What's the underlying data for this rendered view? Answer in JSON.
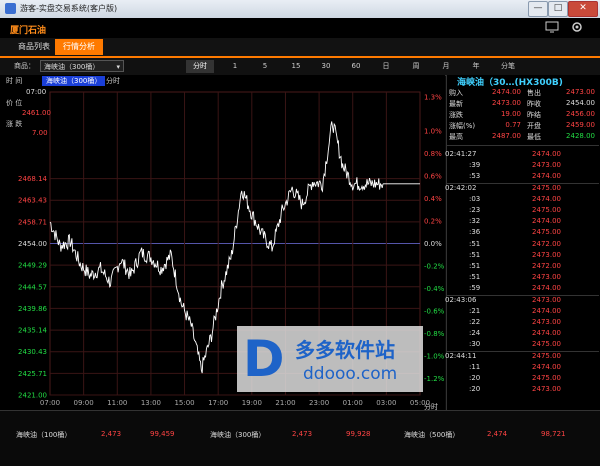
{
  "window": {
    "title": "游客-实盘交易系统(客户版)",
    "min": "—",
    "max": "□",
    "close": "✕"
  },
  "header": {
    "logo": "厦门石油"
  },
  "tabs": [
    {
      "label": "商品列表"
    },
    {
      "label": "行情分析"
    }
  ],
  "toolbar": {
    "goods_label": "商品：",
    "selected": "海峡油（300桶）",
    "periods": [
      "分时",
      "1",
      "5",
      "15",
      "30",
      "60",
      "日",
      "周",
      "月",
      "年",
      "分笔"
    ]
  },
  "chart": {
    "left_labels": {
      "time": "时 间",
      "time_val": "07:00",
      "price": "价 位",
      "price_val": "2461.00",
      "change": "涨 跌",
      "change_val": "7.00"
    },
    "legend": "海峡油（300桶）",
    "legend_suffix": "分时",
    "x_unit": "分时",
    "colors": {
      "up": "#ff4444",
      "down": "#22dd44",
      "line": "#ffffff",
      "grid": "#3a1515",
      "accent": "#ff7a00"
    }
  },
  "chart_data": {
    "type": "line",
    "title": "海峡油（300桶）",
    "xlabel": "分时",
    "ylabel": "",
    "x_ticks": [
      "07:00",
      "09:00",
      "11:00",
      "13:00",
      "15:00",
      "17:00",
      "19:00",
      "21:00",
      "23:00",
      "01:00",
      "03:00",
      "05:00"
    ],
    "y_ticks": [
      "2468.14",
      "2463.43",
      "2458.71",
      "2454.00",
      "2449.29",
      "2444.57",
      "2439.86",
      "2435.14",
      "2430.43",
      "2425.71",
      "2421.00"
    ],
    "pct_ticks": [
      "1.3%",
      "1.0%",
      "0.8%",
      "0.6%",
      "0.4%",
      "0.2%",
      "0.0%",
      "-0.2%",
      "-0.4%",
      "-0.6%",
      "-0.8%",
      "-1.0%",
      "-1.2%"
    ],
    "ylim": [
      2421.0,
      2487.0
    ],
    "base": 2454.0,
    "series": [
      {
        "x": [
          "07:00",
          "08:00",
          "09:00",
          "10:00",
          "11:00",
          "12:00",
          "13:00",
          "14:00",
          "15:00",
          "16:00",
          "17:00",
          "17:30",
          "18:00",
          "18:30",
          "19:00",
          "19:30",
          "20:00",
          "20:30",
          "21:00",
          "21:30",
          "22:00",
          "22:30",
          "23:00",
          "23:30",
          "00:00",
          "00:30",
          "01:00",
          "01:30",
          "02:00",
          "02:30",
          "03:00",
          "03:30",
          "04:00",
          "04:30"
        ],
        "values": [
          2458.7,
          2453.5,
          2454.5,
          2449.5,
          2447.0,
          2448.5,
          2445.5,
          2450.5,
          2447.0,
          2452.0,
          2451.0,
          2448.5,
          2451.5,
          2441.0,
          2436.0,
          2426.5,
          2434.0,
          2444.5,
          2451.5,
          2466.0,
          2460.5,
          2456.0,
          2453.0,
          2461.0,
          2466.0,
          2462.5,
          2467.5,
          2467.0,
          2480.5,
          2471.0,
          2467.0,
          2467.0,
          2467.0,
          2467.0
        ]
      }
    ]
  },
  "quote": {
    "title": "海峡油（30…(HX300B)",
    "rows": [
      {
        "k1": "购入",
        "v1": "2474.00",
        "c1": "red",
        "k2": "售出",
        "v2": "2473.00",
        "c2": "red"
      },
      {
        "k1": "最新",
        "v1": "2473.00",
        "c1": "red",
        "k2": "昨收",
        "v2": "2454.00",
        "c2": "white"
      },
      {
        "k1": "涨跌",
        "v1": "19.00",
        "c1": "red",
        "k2": "昨结",
        "v2": "2456.00",
        "c2": "red"
      },
      {
        "k1": "涨幅(%)",
        "v1": "0.77",
        "c1": "red",
        "k2": "开盘",
        "v2": "2459.00",
        "c2": "red"
      },
      {
        "k1": "最高",
        "v1": "2487.00",
        "c1": "red",
        "k2": "最低",
        "v2": "2428.00",
        "c2": "green"
      }
    ],
    "ticks": [
      {
        "t": "02:41:27",
        "p": "2474.00"
      },
      {
        "t": ":39",
        "p": "2473.00"
      },
      {
        "t": ":53",
        "p": "2474.00"
      },
      {
        "t": "02:42:02",
        "p": "2475.00"
      },
      {
        "t": ":03",
        "p": "2474.00"
      },
      {
        "t": ":23",
        "p": "2475.00"
      },
      {
        "t": ":32",
        "p": "2474.00"
      },
      {
        "t": ":36",
        "p": "2475.00"
      },
      {
        "t": ":51",
        "p": "2472.00"
      },
      {
        "t": ":51",
        "p": "2473.00"
      },
      {
        "t": ":51",
        "p": "2472.00"
      },
      {
        "t": ":51",
        "p": "2473.00"
      },
      {
        "t": ":59",
        "p": "2474.00"
      },
      {
        "t": "02:43:06",
        "p": "2473.00"
      },
      {
        "t": ":21",
        "p": "2474.00"
      },
      {
        "t": ":22",
        "p": "2473.00"
      },
      {
        "t": ":24",
        "p": "2474.00"
      },
      {
        "t": ":30",
        "p": "2475.00"
      },
      {
        "t": "02:44:11",
        "p": "2475.00"
      },
      {
        "t": ":11",
        "p": "2474.00"
      },
      {
        "t": ":20",
        "p": "2475.00"
      },
      {
        "t": ":20",
        "p": "2473.00"
      }
    ]
  },
  "bottom": [
    {
      "name": "海峡油（100桶）",
      "price": "2,473",
      "vol": "99,459"
    },
    {
      "name": "海峡油（300桶）",
      "price": "2,473",
      "vol": "99,928"
    },
    {
      "name": "海峡油（500桶）",
      "price": "2,474",
      "vol": "98,721"
    }
  ],
  "watermark": {
    "text": "多多软件站",
    "sub": "ddooo.com",
    "logo": "D"
  }
}
